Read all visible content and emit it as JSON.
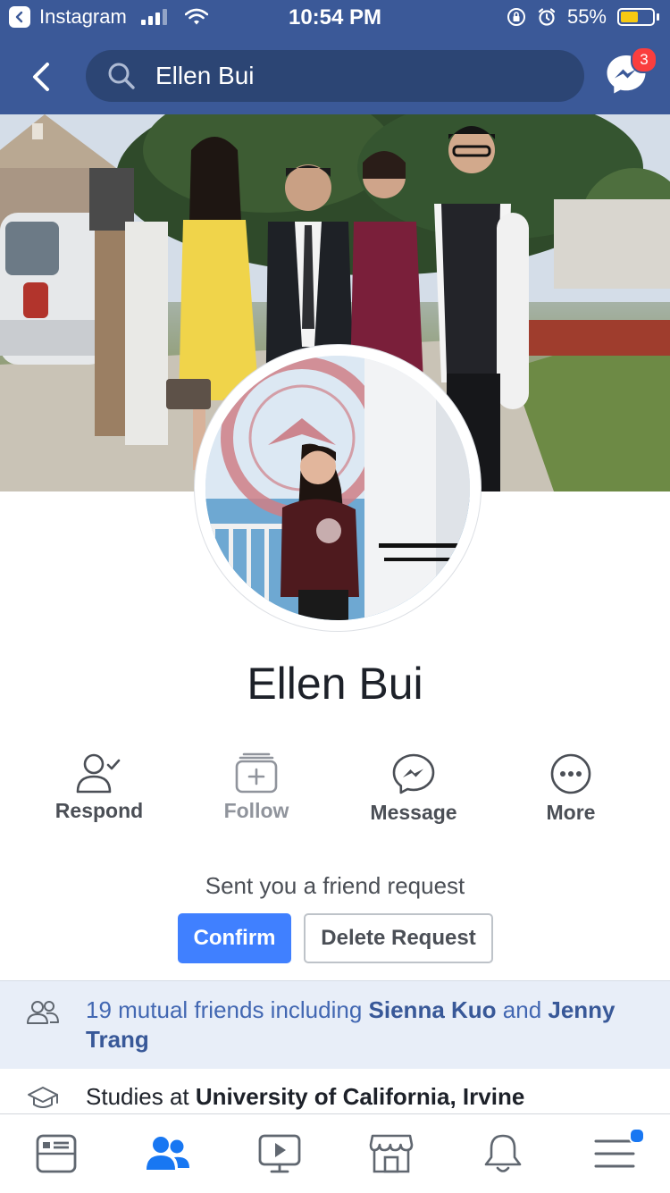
{
  "status_bar": {
    "back_app_label": "Instagram",
    "time": "10:54 PM",
    "battery_percent": "55%",
    "battery_level": 0.55
  },
  "header": {
    "search_text": "Ellen Bui",
    "messenger_badge_count": "3",
    "bar_color": "#3b5998"
  },
  "profile": {
    "name": "Ellen Bui"
  },
  "actions": [
    {
      "label": "Respond",
      "icon": "person-check-icon"
    },
    {
      "label": "Follow",
      "icon": "follow-inbox-icon"
    },
    {
      "label": "Message",
      "icon": "messenger-icon"
    },
    {
      "label": "More",
      "icon": "more-icon"
    }
  ],
  "friend_request": {
    "text": "Sent you a friend request",
    "confirm_label": "Confirm",
    "delete_label": "Delete Request"
  },
  "mutual_friends": {
    "prefix": "19 mutual friends including ",
    "friend_1": "Sienna Kuo",
    "connector": " and ",
    "friend_2": "Jenny Trang"
  },
  "studies": {
    "prefix": "Studies at ",
    "school": "University of California, Irvine"
  },
  "tabs": [
    {
      "name": "news-feed-tab",
      "icon": "news-feed-icon"
    },
    {
      "name": "friends-tab",
      "icon": "friends-icon"
    },
    {
      "name": "watch-tab",
      "icon": "watch-icon"
    },
    {
      "name": "marketplace-tab",
      "icon": "marketplace-icon"
    },
    {
      "name": "notifications-tab",
      "icon": "bell-icon"
    },
    {
      "name": "menu-tab",
      "icon": "menu-icon"
    }
  ],
  "colors": {
    "accent_blue": "#4080ff",
    "link_blue": "#385898",
    "mutual_bg": "#e8eef8"
  }
}
